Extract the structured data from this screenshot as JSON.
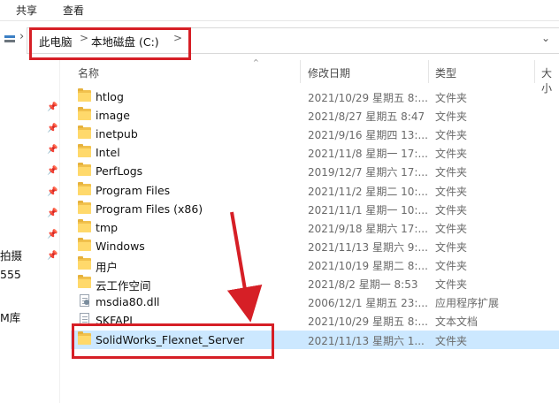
{
  "ribbon": {
    "tabs": [
      "共享",
      "查看"
    ]
  },
  "address_bar": {
    "crumbs": [
      "此电脑",
      "本地磁盘 (C:)"
    ],
    "separator": ">",
    "dropdown": "⌄"
  },
  "nav_pane": {
    "partial_labels": [
      "拍摄",
      "555",
      "M库"
    ],
    "pin_icon": "pin-icon"
  },
  "columns": {
    "name": "名称",
    "date": "修改日期",
    "type": "类型",
    "size": "大小"
  },
  "files": [
    {
      "name": "htlog",
      "date": "2021/10/29 星期五 8:...",
      "type": "文件夹",
      "icon": "folder-icon"
    },
    {
      "name": "image",
      "date": "2021/8/27 星期五 8:47",
      "type": "文件夹",
      "icon": "folder-icon"
    },
    {
      "name": "inetpub",
      "date": "2021/9/16 星期四 13:...",
      "type": "文件夹",
      "icon": "folder-icon"
    },
    {
      "name": "Intel",
      "date": "2021/11/8 星期一 17:...",
      "type": "文件夹",
      "icon": "folder-icon"
    },
    {
      "name": "PerfLogs",
      "date": "2019/12/7 星期六 17:...",
      "type": "文件夹",
      "icon": "folder-icon"
    },
    {
      "name": "Program Files",
      "date": "2021/11/2 星期二 10:...",
      "type": "文件夹",
      "icon": "folder-icon"
    },
    {
      "name": "Program Files (x86)",
      "date": "2021/11/1 星期一 10:...",
      "type": "文件夹",
      "icon": "folder-icon"
    },
    {
      "name": "tmp",
      "date": "2021/9/18 星期六 17:...",
      "type": "文件夹",
      "icon": "folder-icon"
    },
    {
      "name": "Windows",
      "date": "2021/11/13 星期六 9:...",
      "type": "文件夹",
      "icon": "folder-icon"
    },
    {
      "name": "用户",
      "date": "2021/10/19 星期二 8:...",
      "type": "文件夹",
      "icon": "folder-icon"
    },
    {
      "name": "云工作空间",
      "date": "2021/8/2 星期一 8:53",
      "type": "文件夹",
      "icon": "folder-icon"
    },
    {
      "name": "msdia80.dll",
      "date": "2006/12/1 星期五 23:...",
      "type": "应用程序扩展",
      "icon": "dll-icon"
    },
    {
      "name": "SKFAPI",
      "date": "2021/10/29 星期五 8:...",
      "type": "文本文档",
      "icon": "text-file-icon"
    },
    {
      "name": "SolidWorks_Flexnet_Server",
      "date": "2021/11/13 星期六 1...",
      "type": "文件夹",
      "icon": "folder-icon",
      "selected": true
    }
  ],
  "colors": {
    "selection": "#cce8ff",
    "highlight_box": "#d61f26",
    "folder": "#ffd96b"
  }
}
